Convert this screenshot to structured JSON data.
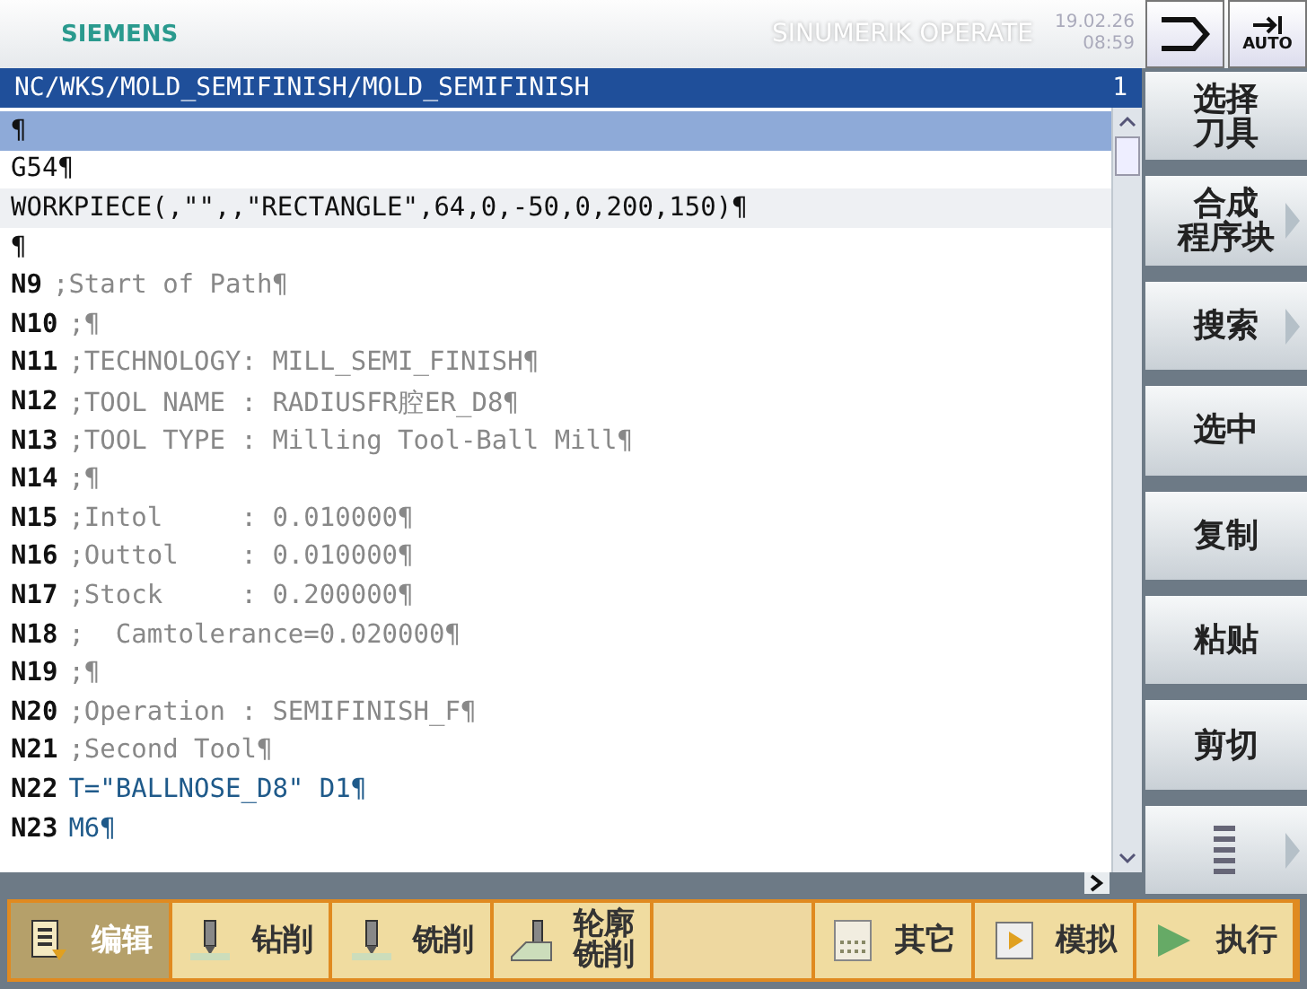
{
  "header": {
    "brand": "SIEMENS",
    "product": "SINUMERIK OPERATE",
    "date": "19.02.26",
    "time": "08:59",
    "mode_buttons": [
      {
        "kind": "channel"
      },
      {
        "kind": "auto",
        "label": "AUTO"
      }
    ]
  },
  "editor": {
    "path": "NC/WKS/MOLD_SEMIFINISH/MOLD_SEMIFINISH",
    "channel": "1",
    "lines": [
      {
        "text": "¶",
        "kind": "code",
        "selected": true
      },
      {
        "text": "G54¶",
        "kind": "code",
        "selected": false
      },
      {
        "text": "WORKPIECE(,\"\",,\"RECTANGLE\",64,0,-50,0,200,150)¶",
        "kind": "cycle",
        "selected": false
      },
      {
        "text": "¶",
        "kind": "code",
        "selected": false
      },
      {
        "number": "N9",
        "text": ";Start of Path¶",
        "kind": "comment",
        "selected": false
      },
      {
        "number": "N10",
        "text": ";¶",
        "kind": "comment",
        "selected": false
      },
      {
        "number": "N11",
        "text": ";TECHNOLOGY: MILL_SEMI_FINISH¶",
        "kind": "comment",
        "selected": false
      },
      {
        "number": "N12",
        "text": ";TOOL NAME : RADIUSFR腔ER_D8¶",
        "kind": "comment",
        "selected": false
      },
      {
        "number": "N13",
        "text": ";TOOL TYPE : Milling Tool-Ball Mill¶",
        "kind": "comment",
        "selected": false
      },
      {
        "number": "N14",
        "text": ";¶",
        "kind": "comment",
        "selected": false
      },
      {
        "number": "N15",
        "text": ";Intol     : 0.010000¶",
        "kind": "comment",
        "selected": false
      },
      {
        "number": "N16",
        "text": ";Outtol    : 0.010000¶",
        "kind": "comment",
        "selected": false
      },
      {
        "number": "N17",
        "text": ";Stock     : 0.200000¶",
        "kind": "comment",
        "selected": false
      },
      {
        "number": "N18",
        "text": ";  Camtolerance=0.020000¶",
        "kind": "comment",
        "selected": false
      },
      {
        "number": "N19",
        "text": ";¶",
        "kind": "comment",
        "selected": false
      },
      {
        "number": "N20",
        "text": ";Operation : SEMIFINISH_F¶",
        "kind": "comment",
        "selected": false
      },
      {
        "number": "N21",
        "text": ";Second Tool¶",
        "kind": "comment",
        "selected": false
      },
      {
        "number": "N22",
        "text": "T=\"BALLNOSE_D8\" D1¶",
        "kind": "tool",
        "selected": false
      },
      {
        "number": "N23",
        "text": "M6¶",
        "kind": "tool",
        "selected": false
      }
    ]
  },
  "softkeys": [
    {
      "label_lines": [
        "选择",
        "刀具"
      ],
      "arrow": false
    },
    {
      "label_lines": [
        "合成",
        "程序块"
      ],
      "arrow": true
    },
    {
      "label_lines": [
        "搜索"
      ],
      "arrow": true
    },
    {
      "label_lines": [
        "选中"
      ],
      "arrow": false
    },
    {
      "label_lines": [
        "复制"
      ],
      "arrow": false
    },
    {
      "label_lines": [
        "粘贴"
      ],
      "arrow": false
    },
    {
      "label_lines": [
        "剪切"
      ],
      "arrow": false
    },
    {
      "kind": "more",
      "arrow": true
    }
  ],
  "tabs": [
    {
      "label_lines": [
        "编辑"
      ],
      "kind": "edit",
      "selected": true
    },
    {
      "label_lines": [
        "钻削"
      ],
      "kind": "drill",
      "selected": false
    },
    {
      "label_lines": [
        "铣削"
      ],
      "kind": "mill",
      "selected": false
    },
    {
      "label_lines": [
        "轮廓",
        "铣削"
      ],
      "kind": "contour",
      "selected": false
    },
    {
      "kind": "empty",
      "selected": false
    },
    {
      "label_lines": [
        "其它"
      ],
      "kind": "nc",
      "selected": false
    },
    {
      "label_lines": [
        "模拟"
      ],
      "kind": "play",
      "selected": false
    },
    {
      "label_lines": [
        "执行"
      ],
      "kind": "run",
      "selected": false
    }
  ]
}
